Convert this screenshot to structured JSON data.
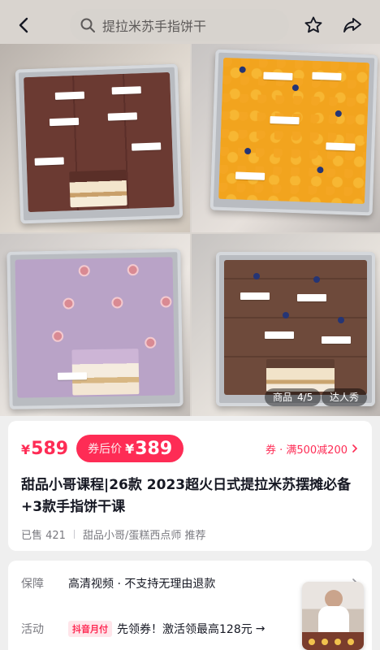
{
  "top_bar": {
    "search_text": "提拉米苏手指饼干",
    "icons": {
      "back": "chevron-left-icon",
      "search": "search-icon",
      "favorite": "star-icon",
      "share": "share-icon"
    }
  },
  "gallery": {
    "page_label": "商品",
    "page_index": "4/5",
    "buyer_show_label": "达人秀"
  },
  "price": {
    "currency": "¥",
    "original": "589",
    "after_coupon_label": "券后价",
    "after_coupon_value": "389",
    "promo_text": "券 · 满500减200",
    "colors": {
      "accent": "#fe2c55"
    }
  },
  "product": {
    "title": "甜品小哥课程|26款 2023超火日式提拉米苏摆摊必备+3款手指饼干课",
    "sold": "已售 421",
    "recommender": "甜品小哥/蛋糕西点师 推荐"
  },
  "info": {
    "guarantee": {
      "label": "保障",
      "value": "高清视频 · 不支持无理由退款"
    },
    "activity": {
      "label": "活动",
      "tag": "抖音月付",
      "value": "先领券！激活领最高128元",
      "arrow": "→"
    }
  }
}
